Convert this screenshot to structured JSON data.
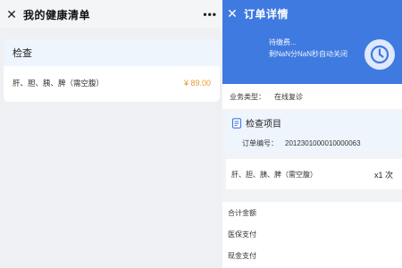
{
  "left": {
    "title": "我的健康清单",
    "more": "•••",
    "card": {
      "header": "检查",
      "item": "肝、胆、胰、脾（需空腹）",
      "price": "¥ 89.00"
    }
  },
  "right": {
    "title": "订单详情",
    "banner": {
      "status": "待缴费...",
      "countdown": "剩NaN分NaN秒自动关闭"
    },
    "business": {
      "label": "业务类型：",
      "value": "在线复诊"
    },
    "items_section": {
      "title": "检查项目",
      "order_label": "订单编号：",
      "order_no": "2012301000010000063"
    },
    "item": {
      "name": "肝、胆、胰、脾（需空腹）",
      "qty": "x1 次"
    },
    "summary": [
      "合计金额",
      "医保支付",
      "现金支付"
    ]
  },
  "colors": {
    "accent": "#3f7ae0",
    "price": "#e89a32",
    "light_blue": "#eef5fd"
  },
  "icons": [
    "close-icon",
    "more-icon",
    "clock-icon",
    "document-icon"
  ]
}
